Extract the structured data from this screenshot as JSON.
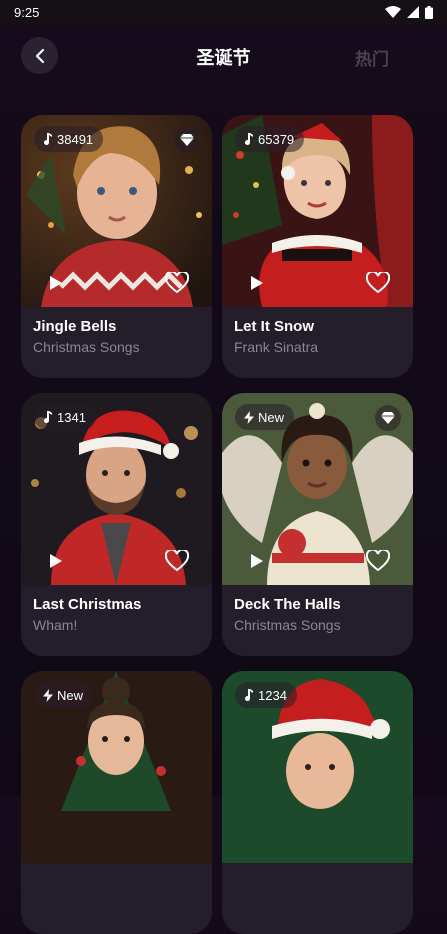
{
  "status_bar": {
    "time": "9:25"
  },
  "header": {
    "title": "圣诞节",
    "hot_tab": "热门"
  },
  "cards": [
    {
      "title": "Jingle Bells",
      "artist": "Christmas Songs",
      "badge": "38491",
      "badge_icon": "music-note-icon",
      "premium": true
    },
    {
      "title": "Let It Snow",
      "artist": "Frank Sinatra",
      "badge": "65379",
      "badge_icon": "music-note-icon",
      "premium": false
    },
    {
      "title": "Last Christmas",
      "artist": "Wham!",
      "badge": "1341",
      "badge_icon": "music-note-icon",
      "premium": false
    },
    {
      "title": "Deck The Halls",
      "artist": "Christmas Songs",
      "badge": "New",
      "badge_icon": "lightning-icon",
      "premium": true
    },
    {
      "title": "",
      "artist": "",
      "badge": "New",
      "badge_icon": "lightning-icon",
      "premium": false
    },
    {
      "title": "",
      "artist": "",
      "badge": "1234",
      "badge_icon": "music-note-icon",
      "premium": false
    }
  ]
}
